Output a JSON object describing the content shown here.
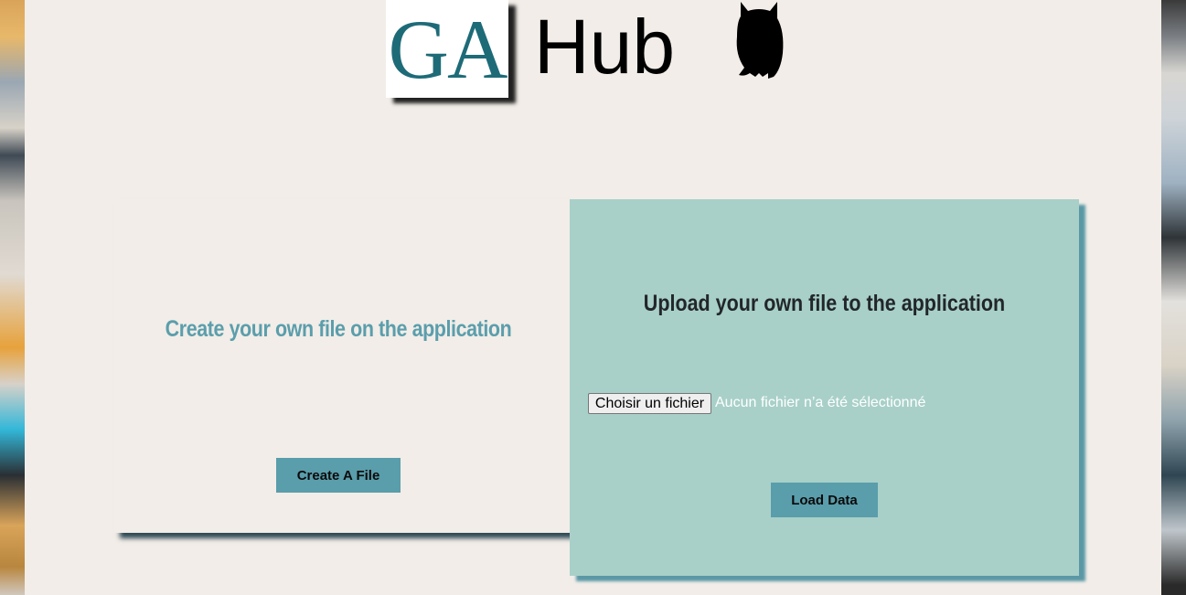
{
  "header": {
    "logo_ga": "GA",
    "logo_hub": "Hub",
    "owl_icon": "owl-silhouette-icon"
  },
  "create_card": {
    "title": "Create your own file on the application",
    "button_label": "Create A File"
  },
  "upload_card": {
    "title": "Upload your own file to the application",
    "file_button_label": "Choisir un fichier",
    "file_status": "Aucun fichier n’a été sélectionné",
    "button_label": "Load Data"
  },
  "colors": {
    "page_background": "#f2ede8",
    "brand_teal": "#1e6b78",
    "button_teal": "#5a9dab",
    "upload_card_bg": "#a8d0c8",
    "create_title_color": "#5b9eac"
  }
}
